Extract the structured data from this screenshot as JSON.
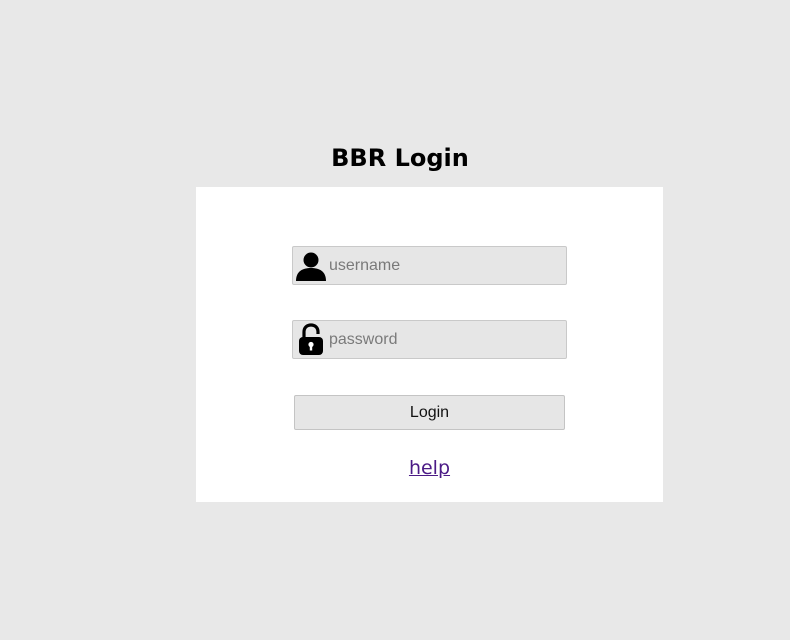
{
  "page": {
    "title": "BBR Login"
  },
  "form": {
    "username_placeholder": "username",
    "password_placeholder": "password",
    "login_label": "Login",
    "help_label": "help"
  },
  "icons": {
    "username": "user-icon",
    "password": "lock-icon"
  },
  "colors": {
    "background": "#e8e8e8",
    "panel": "#ffffff",
    "field": "#e6e6e6",
    "link": "#4b1a86"
  }
}
